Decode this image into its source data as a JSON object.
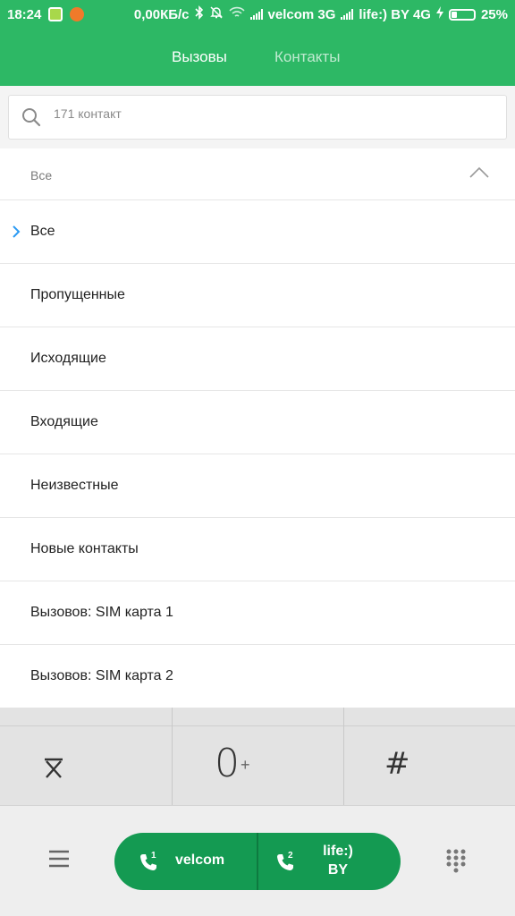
{
  "status_bar": {
    "time": "18:24",
    "speed": "0,00КБ/с",
    "carrier1": "velcom 3G",
    "carrier2": "life:) BY 4G",
    "battery": "25%",
    "battery_level": 0.25
  },
  "tabs": {
    "calls": "Вызовы",
    "contacts": "Контакты"
  },
  "search": {
    "placeholder": "171 контакт",
    "icon": "search-icon"
  },
  "filter": {
    "header_label": "Все",
    "items": [
      {
        "label": "Все",
        "selected": true
      },
      {
        "label": "Пропущенные"
      },
      {
        "label": "Исходящие"
      },
      {
        "label": "Входящие"
      },
      {
        "label": "Неизвестные"
      },
      {
        "label": "Новые контакты"
      },
      {
        "label": "Вызовов: SIM карта 1"
      },
      {
        "label": "Вызовов: SIM карта 2"
      }
    ]
  },
  "keypad": {
    "star": "*",
    "zero": "0",
    "zero_sub": "+",
    "hash": "#"
  },
  "bottom": {
    "sim1_label": "velcom",
    "sim1_index": "1",
    "sim2_label_line1": "life:)",
    "sim2_label_line2": "BY",
    "sim2_index": "2"
  },
  "colors": {
    "accent": "#2db865",
    "call_button": "#149a52",
    "check": "#2b9af3"
  }
}
